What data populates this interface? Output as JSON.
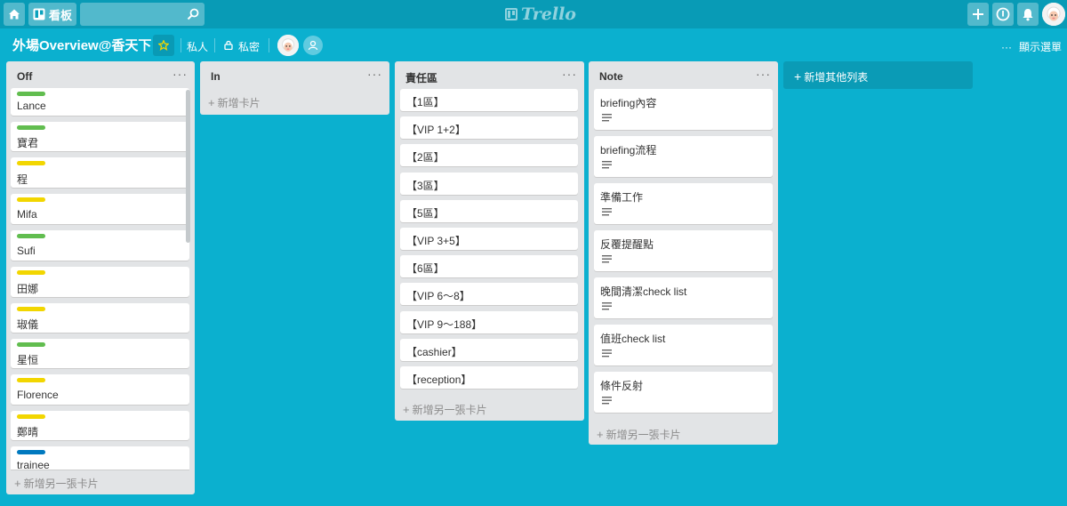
{
  "header": {
    "boards_label": "看板",
    "search_value": "",
    "logo_text": "Trello"
  },
  "board": {
    "title": "外場Overview@香天下",
    "visibility_team": "私人",
    "visibility_privacy": "私密",
    "show_menu_label": "顯示選單",
    "add_list_label": "新增其他列表"
  },
  "colors": {
    "green": "#61bd4f",
    "yellow": "#f2d600",
    "blue": "#0079bf"
  },
  "lists": [
    {
      "title": "Off",
      "add_card_label": "新增另一張卡片",
      "cards": [
        {
          "text": "Lance",
          "label": "green"
        },
        {
          "text": "寶君",
          "label": "green"
        },
        {
          "text": "程",
          "label": "yellow"
        },
        {
          "text": "Mifa",
          "label": "yellow"
        },
        {
          "text": "Sufi",
          "label": "green"
        },
        {
          "text": "田娜",
          "label": "yellow"
        },
        {
          "text": "琡儀",
          "label": "yellow"
        },
        {
          "text": "星恒",
          "label": "green"
        },
        {
          "text": "Florence",
          "label": "yellow"
        },
        {
          "text": "鄭晴",
          "label": "yellow"
        },
        {
          "text": "trainee",
          "label": "blue"
        }
      ]
    },
    {
      "title": "In",
      "add_card_label": "新增卡片",
      "cards": []
    },
    {
      "title": "責任區",
      "add_card_label": "新增另一張卡片",
      "cards": [
        {
          "text": "【1區】"
        },
        {
          "text": "【VIP 1+2】"
        },
        {
          "text": "【2區】"
        },
        {
          "text": "【3區】"
        },
        {
          "text": "【5區】"
        },
        {
          "text": "【VIP 3+5】"
        },
        {
          "text": "【6區】"
        },
        {
          "text": "【VIP 6～8】"
        },
        {
          "text": "【VIP 9～188】"
        },
        {
          "text": "【cashier】"
        },
        {
          "text": "【reception】"
        }
      ]
    },
    {
      "title": "Note",
      "add_card_label": "新增另一張卡片",
      "cards": [
        {
          "text": "briefing內容",
          "has_description": true
        },
        {
          "text": "briefing流程",
          "has_description": true
        },
        {
          "text": "準備工作",
          "has_description": true
        },
        {
          "text": "反覆提醒點",
          "has_description": true
        },
        {
          "text": "晚間清潔check list",
          "has_description": true
        },
        {
          "text": "值班check list",
          "has_description": true
        },
        {
          "text": "條件反射",
          "has_description": true
        }
      ]
    }
  ]
}
